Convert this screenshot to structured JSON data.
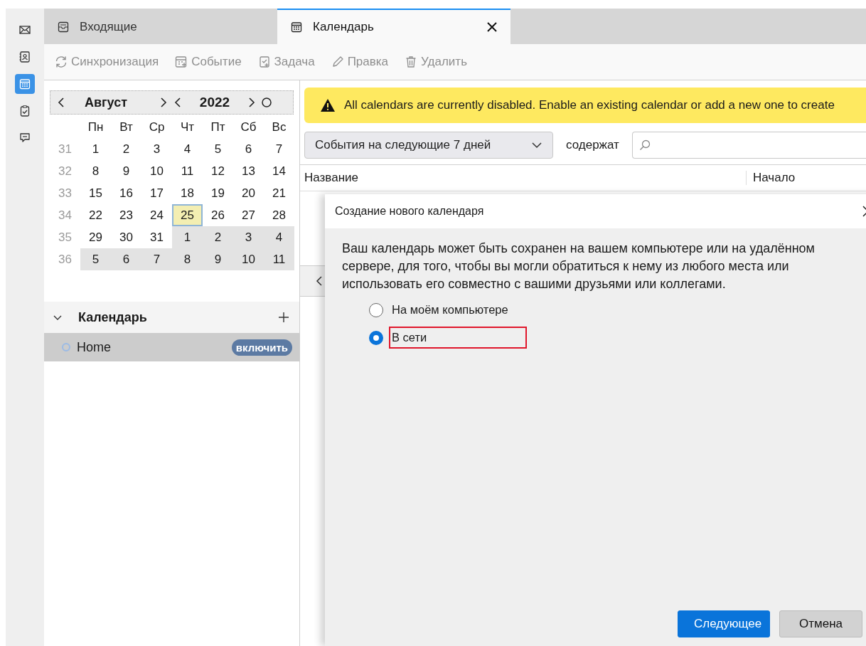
{
  "rail": [
    {
      "kind": "mail",
      "selected": false
    },
    {
      "kind": "contacts",
      "selected": false
    },
    {
      "kind": "calendar",
      "selected": true
    },
    {
      "kind": "tasks",
      "selected": false
    },
    {
      "kind": "chat",
      "selected": false
    }
  ],
  "tabs": [
    {
      "kind": "inbox",
      "label": "Входящие",
      "selected": false,
      "closable": false
    },
    {
      "kind": "calendar",
      "label": "Календарь",
      "selected": true,
      "closable": true
    }
  ],
  "toolbar": [
    {
      "kind": "sync",
      "label": "Синхронизация",
      "disabled": true
    },
    {
      "kind": "event",
      "label": "Событие",
      "disabled": true
    },
    {
      "kind": "task",
      "label": "Задача",
      "disabled": true
    },
    {
      "kind": "edit",
      "label": "Правка",
      "disabled": true
    },
    {
      "kind": "delete",
      "label": "Удалить",
      "disabled": true
    }
  ],
  "minimonth": {
    "month": "Август",
    "year": "2022",
    "weekdays": [
      "Пн",
      "Вт",
      "Ср",
      "Чт",
      "Пт",
      "Сб",
      "Вс"
    ],
    "weeks": [
      {
        "number": "31",
        "days": [
          {
            "day": "1",
            "outside": false,
            "today": false
          },
          {
            "day": "2",
            "outside": false,
            "today": false
          },
          {
            "day": "3",
            "outside": false,
            "today": false
          },
          {
            "day": "4",
            "outside": false,
            "today": false
          },
          {
            "day": "5",
            "outside": false,
            "today": false
          },
          {
            "day": "6",
            "outside": false,
            "today": false
          },
          {
            "day": "7",
            "outside": false,
            "today": false
          }
        ]
      },
      {
        "number": "32",
        "days": [
          {
            "day": "8",
            "outside": false,
            "today": false
          },
          {
            "day": "9",
            "outside": false,
            "today": false
          },
          {
            "day": "10",
            "outside": false,
            "today": false
          },
          {
            "day": "11",
            "outside": false,
            "today": false
          },
          {
            "day": "12",
            "outside": false,
            "today": false
          },
          {
            "day": "13",
            "outside": false,
            "today": false
          },
          {
            "day": "14",
            "outside": false,
            "today": false
          }
        ]
      },
      {
        "number": "33",
        "days": [
          {
            "day": "15",
            "outside": false,
            "today": false
          },
          {
            "day": "16",
            "outside": false,
            "today": false
          },
          {
            "day": "17",
            "outside": false,
            "today": false
          },
          {
            "day": "18",
            "outside": false,
            "today": false
          },
          {
            "day": "19",
            "outside": false,
            "today": false
          },
          {
            "day": "20",
            "outside": false,
            "today": false
          },
          {
            "day": "21",
            "outside": false,
            "today": false
          }
        ]
      },
      {
        "number": "34",
        "days": [
          {
            "day": "22",
            "outside": false,
            "today": false
          },
          {
            "day": "23",
            "outside": false,
            "today": false
          },
          {
            "day": "24",
            "outside": false,
            "today": false
          },
          {
            "day": "25",
            "outside": false,
            "today": true
          },
          {
            "day": "26",
            "outside": false,
            "today": false
          },
          {
            "day": "27",
            "outside": false,
            "today": false
          },
          {
            "day": "28",
            "outside": false,
            "today": false
          }
        ]
      },
      {
        "number": "35",
        "days": [
          {
            "day": "29",
            "outside": false,
            "today": false
          },
          {
            "day": "30",
            "outside": false,
            "today": false
          },
          {
            "day": "31",
            "outside": false,
            "today": false
          },
          {
            "day": "1",
            "outside": true,
            "today": false
          },
          {
            "day": "2",
            "outside": true,
            "today": false
          },
          {
            "day": "3",
            "outside": true,
            "today": false
          },
          {
            "day": "4",
            "outside": true,
            "today": false
          }
        ]
      },
      {
        "number": "36",
        "days": [
          {
            "day": "5",
            "outside": true,
            "today": false
          },
          {
            "day": "6",
            "outside": true,
            "today": false
          },
          {
            "day": "7",
            "outside": true,
            "today": false
          },
          {
            "day": "8",
            "outside": true,
            "today": false
          },
          {
            "day": "9",
            "outside": true,
            "today": false
          },
          {
            "day": "10",
            "outside": true,
            "today": false
          },
          {
            "day": "11",
            "outside": true,
            "today": false
          }
        ]
      }
    ]
  },
  "calendars": {
    "title": "Календарь",
    "expanded": true,
    "items": [
      {
        "name": "Home",
        "selected": true,
        "enabled": false,
        "action": "включить"
      }
    ]
  },
  "notification": {
    "text": "All calendars are currently disabled. Enable an existing calendar or add a new one to create"
  },
  "filter": {
    "range": "События на следующие 7 дней",
    "label": "содержат"
  },
  "table": {
    "columns": [
      "Название",
      "Начало"
    ]
  },
  "dialog": {
    "title": "Создание нового календаря",
    "text": "Ваш календарь может быть сохранен на вашем компьютере или на удалённом сервере, для того, чтобы вы могли обратиться к нему из любого места или использовать его совместно с вашими друзьями или коллегами.",
    "options": [
      {
        "label": "На моём компьютере",
        "selected": false,
        "highlighted": false
      },
      {
        "label": "В сети",
        "selected": true,
        "highlighted": true
      }
    ],
    "buttons": [
      {
        "label": "Следующее",
        "kind": "primary"
      },
      {
        "label": "Отмена",
        "kind": "secondary"
      }
    ]
  }
}
